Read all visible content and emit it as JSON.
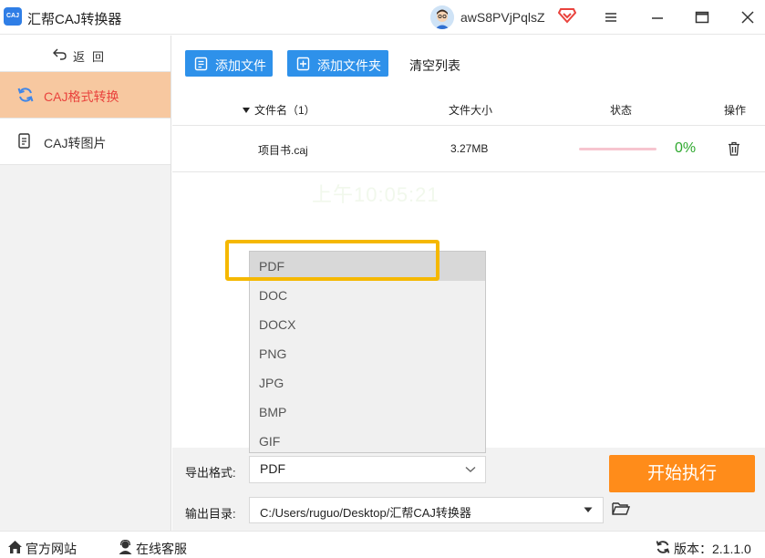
{
  "app": {
    "logo_text": "CAJ",
    "title": "汇帮CAJ转换器"
  },
  "user": {
    "name": "awS8PVjPqlsZ"
  },
  "sidebar": {
    "back_label": "返回",
    "items": [
      {
        "label": "CAJ格式转换",
        "active": true,
        "icon": "refresh-icon"
      },
      {
        "label": "CAJ转图片",
        "active": false,
        "icon": "document-icon"
      }
    ]
  },
  "toolbar": {
    "add_file": "添加文件",
    "add_folder": "添加文件夹",
    "clear_list": "清空列表"
  },
  "table": {
    "headers": {
      "name": "文件名（1）",
      "size": "文件大小",
      "status": "状态",
      "action": "操作"
    },
    "rows": [
      {
        "name": "项目书.caj",
        "size": "3.27MB",
        "progress": 0,
        "progress_text": "0%"
      }
    ]
  },
  "format_options": [
    "PDF",
    "DOC",
    "DOCX",
    "PNG",
    "JPG",
    "BMP",
    "GIF"
  ],
  "settings": {
    "format_label": "导出格式:",
    "format_value": "PDF",
    "output_label": "输出目录:",
    "output_value": "C:/Users/ruguo/Desktop/汇帮CAJ转换器",
    "start_button": "开始执行"
  },
  "statusbar": {
    "website": "官方网站",
    "support": "在线客服",
    "version": "版本：2.1.1.0"
  },
  "colors": {
    "accent_blue": "#2e91ea",
    "accent_orange": "#ff8c1a",
    "active_nav": "#f7c8a0",
    "active_text": "#e9433d",
    "progress_green": "#2ea82e",
    "highlight": "#f5b800"
  }
}
